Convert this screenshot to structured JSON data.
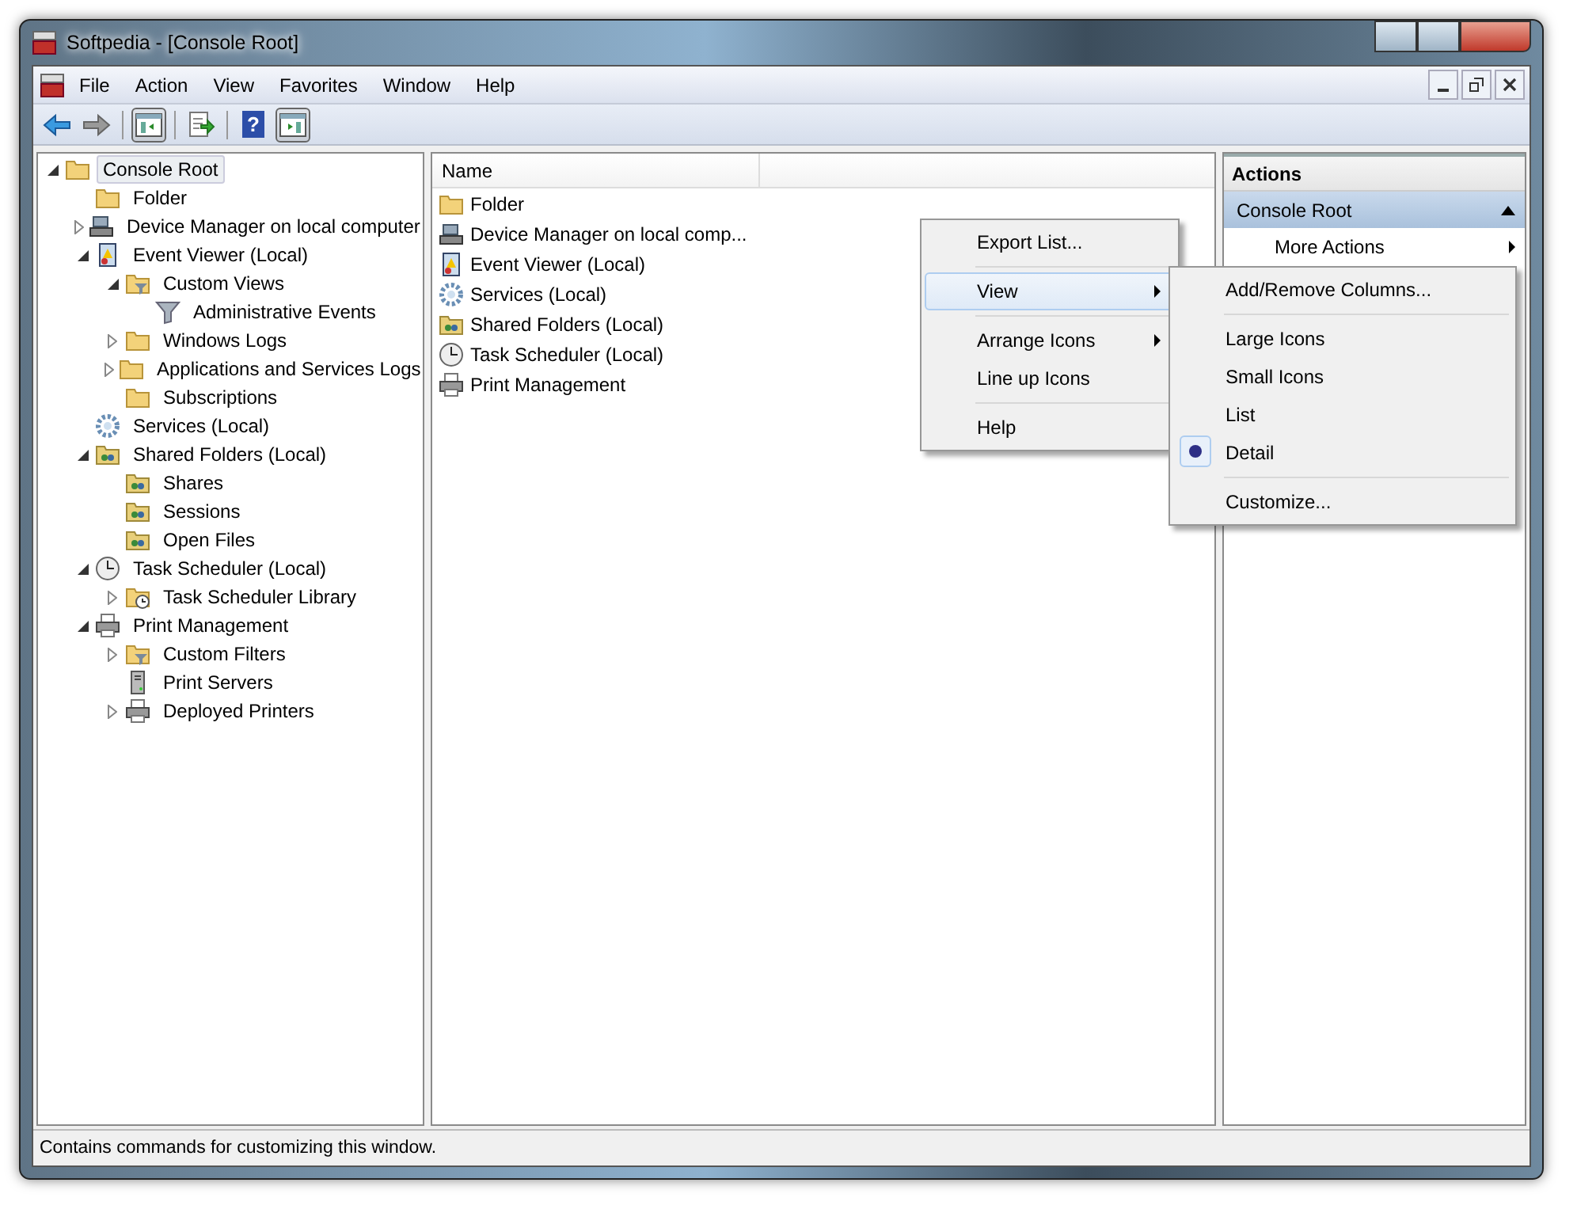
{
  "window": {
    "title": "Softpedia - [Console Root]"
  },
  "menu_bar": [
    "File",
    "Action",
    "View",
    "Favorites",
    "Window",
    "Help"
  ],
  "toolbar": [
    {
      "kind": "back",
      "pressed": false
    },
    {
      "kind": "forward",
      "pressed": false
    },
    {
      "kind": "tree-toggle",
      "pressed": true
    },
    {
      "kind": "export",
      "pressed": false
    },
    {
      "kind": "help",
      "pressed": false,
      "label": "?"
    },
    {
      "kind": "pane-toggle",
      "pressed": true
    }
  ],
  "tree": [
    {
      "label": "Console Root",
      "kind": "folder",
      "selected": true,
      "expanded": true,
      "children": [
        {
          "label": "Folder",
          "kind": "folder",
          "selected": false
        },
        {
          "label": "Device Manager on local computer",
          "kind": "computer",
          "selected": false,
          "expanded": false
        },
        {
          "label": "Event Viewer (Local)",
          "kind": "log",
          "selected": false,
          "expanded": true,
          "children": [
            {
              "label": "Custom Views",
              "kind": "filter-folder",
              "selected": false,
              "expanded": true,
              "children": [
                {
                  "label": "Administrative Events",
                  "kind": "filter",
                  "selected": false
                }
              ]
            },
            {
              "label": "Windows Logs",
              "kind": "folder",
              "selected": false,
              "expanded": false
            },
            {
              "label": "Applications and Services Logs",
              "kind": "folder",
              "selected": false,
              "expanded": false
            },
            {
              "label": "Subscriptions",
              "kind": "folder",
              "selected": false
            }
          ]
        },
        {
          "label": "Services (Local)",
          "kind": "gear",
          "selected": false
        },
        {
          "label": "Shared Folders (Local)",
          "kind": "shared",
          "selected": false,
          "expanded": true,
          "children": [
            {
              "label": "Shares",
              "kind": "shared",
              "selected": false
            },
            {
              "label": "Sessions",
              "kind": "shared",
              "selected": false
            },
            {
              "label": "Open Files",
              "kind": "shared",
              "selected": false
            }
          ]
        },
        {
          "label": "Task Scheduler (Local)",
          "kind": "clock",
          "selected": false,
          "expanded": true,
          "children": [
            {
              "label": "Task Scheduler Library",
              "kind": "clock-folder",
              "selected": false,
              "expanded": false
            }
          ]
        },
        {
          "label": "Print Management",
          "kind": "printer",
          "selected": false,
          "expanded": true,
          "children": [
            {
              "label": "Custom Filters",
              "kind": "filter-folder",
              "selected": false,
              "expanded": false
            },
            {
              "label": "Print Servers",
              "kind": "server",
              "selected": false
            },
            {
              "label": "Deployed Printers",
              "kind": "printer",
              "selected": false,
              "expanded": false
            }
          ]
        }
      ]
    }
  ],
  "list": {
    "columns": [
      "Name"
    ],
    "rows": [
      {
        "name": "Folder",
        "kind": "folder"
      },
      {
        "name": "Device Manager on local comp...",
        "kind": "computer"
      },
      {
        "name": "Event Viewer (Local)",
        "kind": "log"
      },
      {
        "name": "Services (Local)",
        "kind": "gear"
      },
      {
        "name": "Shared Folders (Local)",
        "kind": "shared"
      },
      {
        "name": "Task Scheduler (Local)",
        "kind": "clock"
      },
      {
        "name": "Print Management",
        "kind": "printer"
      }
    ]
  },
  "actions": {
    "title": "Actions",
    "section": {
      "title": "Console Root",
      "expanded": true
    },
    "items": [
      {
        "label": "More Actions",
        "submenu": true
      }
    ]
  },
  "context_menu": {
    "groups": [
      [
        {
          "label": "Export List...",
          "submenu": false,
          "selected": false
        }
      ],
      [
        {
          "label": "View",
          "submenu": true,
          "selected": true
        }
      ],
      [
        {
          "label": "Arrange Icons",
          "submenu": true,
          "selected": false
        },
        {
          "label": "Line up Icons",
          "submenu": false,
          "selected": false
        }
      ],
      [
        {
          "label": "Help",
          "submenu": false,
          "selected": false
        }
      ]
    ]
  },
  "submenu": {
    "groups": [
      [
        {
          "label": "Add/Remove Columns...",
          "checked": false
        }
      ],
      [
        {
          "label": "Large Icons",
          "checked": false
        },
        {
          "label": "Small Icons",
          "checked": false
        },
        {
          "label": "List",
          "checked": false
        },
        {
          "label": "Detail",
          "checked": true
        }
      ],
      [
        {
          "label": "Customize...",
          "checked": false
        }
      ]
    ]
  },
  "status_bar": "Contains commands for customizing this window."
}
